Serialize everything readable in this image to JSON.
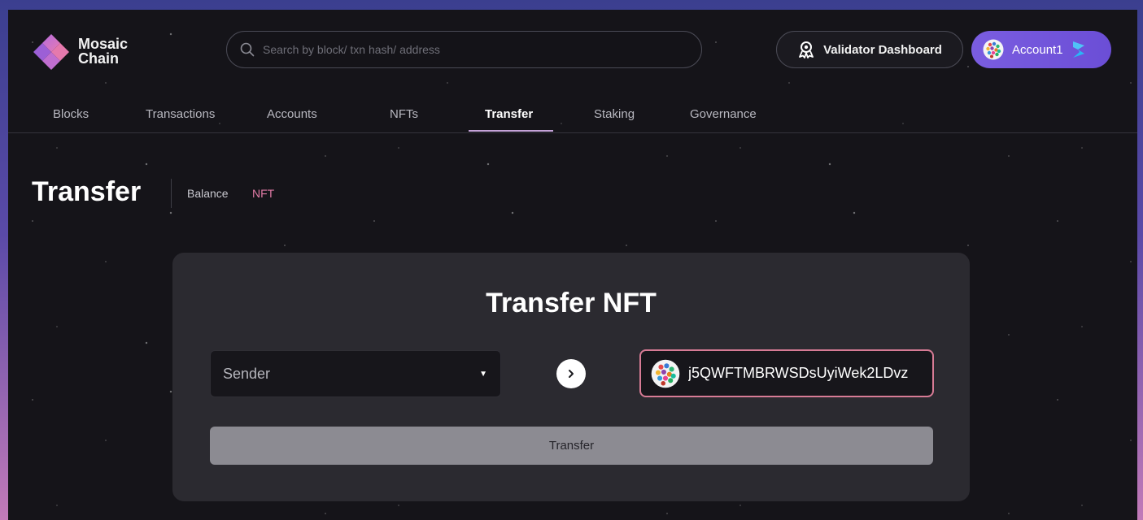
{
  "brand": {
    "name_line1": "Mosaic",
    "name_line2": "Chain"
  },
  "search": {
    "placeholder": "Search by block/ txn hash/ address",
    "value": ""
  },
  "header": {
    "validator_label": "Validator Dashboard",
    "account_label": "Account1"
  },
  "nav": {
    "items": [
      {
        "label": "Blocks"
      },
      {
        "label": "Transactions"
      },
      {
        "label": "Accounts"
      },
      {
        "label": "NFTs"
      },
      {
        "label": "Transfer",
        "active": true
      },
      {
        "label": "Staking"
      },
      {
        "label": "Governance"
      }
    ]
  },
  "page": {
    "title": "Transfer",
    "subtabs": [
      {
        "label": "Balance",
        "active": false
      },
      {
        "label": "NFT",
        "active": true
      }
    ]
  },
  "transfer_card": {
    "title": "Transfer NFT",
    "sender_placeholder": "Sender",
    "recipient_value": "j5QWFTMBRWSDsUyiWek2LDvz",
    "submit_label": "Transfer"
  },
  "colors": {
    "accent_pink": "#e07aa5",
    "active_underline": "#c4a2d8",
    "account_button": "#7a5de0",
    "recipient_border": "#d77b95"
  },
  "icons": {
    "search": "search-icon",
    "validator": "validator-icon",
    "account_avatar": "avatar-icon",
    "network": "network-logo-icon",
    "dropdown": "chevron-down-icon",
    "arrow": "chevron-right-icon"
  }
}
